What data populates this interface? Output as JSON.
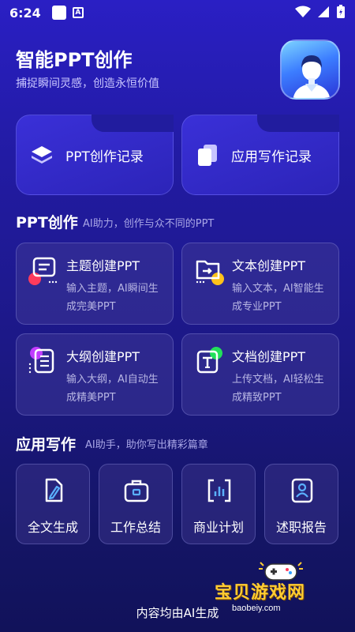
{
  "status_bar": {
    "time": "6:24",
    "a_badge": "A"
  },
  "header": {
    "title": "智能PPT创作",
    "subtitle": "捕捉瞬间灵感，创造永恒价值",
    "avatar_icon": "user-avatar-icon"
  },
  "records": [
    {
      "label": "PPT创作记录",
      "icon": "stack-layers-icon"
    },
    {
      "label": "应用写作记录",
      "icon": "documents-icon"
    }
  ],
  "ppt_section": {
    "title": "PPT创作",
    "subtitle": "AI助力，创作与众不同的PPT",
    "cards": [
      {
        "title": "主题创建PPT",
        "desc": "输入主题，AI瞬间生成完美PPT",
        "icon": "chat-bubble-icon",
        "accent": "#ff3b5c"
      },
      {
        "title": "文本创建PPT",
        "desc": "输入文本，AI智能生成专业PPT",
        "icon": "folder-icon",
        "accent": "#ffc21a"
      },
      {
        "title": "大纲创建PPT",
        "desc": "输入大纲，AI自动生成精美PPT",
        "icon": "list-icon",
        "accent": "#c13cff"
      },
      {
        "title": "文档创建PPT",
        "desc": "上传文档，AI轻松生成精致PPT",
        "icon": "text-document-icon",
        "accent": "#22e05a"
      }
    ]
  },
  "writing_section": {
    "title": "应用写作",
    "subtitle": "AI助手，助你写出精彩篇章",
    "items": [
      {
        "label": "全文生成",
        "icon": "pen-document-icon"
      },
      {
        "label": "工作总结",
        "icon": "briefcase-icon"
      },
      {
        "label": "商业计划",
        "icon": "bar-chart-icon"
      },
      {
        "label": "述职报告",
        "icon": "person-report-icon"
      }
    ]
  },
  "footer": {
    "text": "内容均由AI生成"
  },
  "watermark": {
    "main": "宝贝游戏网",
    "url": "baobeiy.com"
  }
}
